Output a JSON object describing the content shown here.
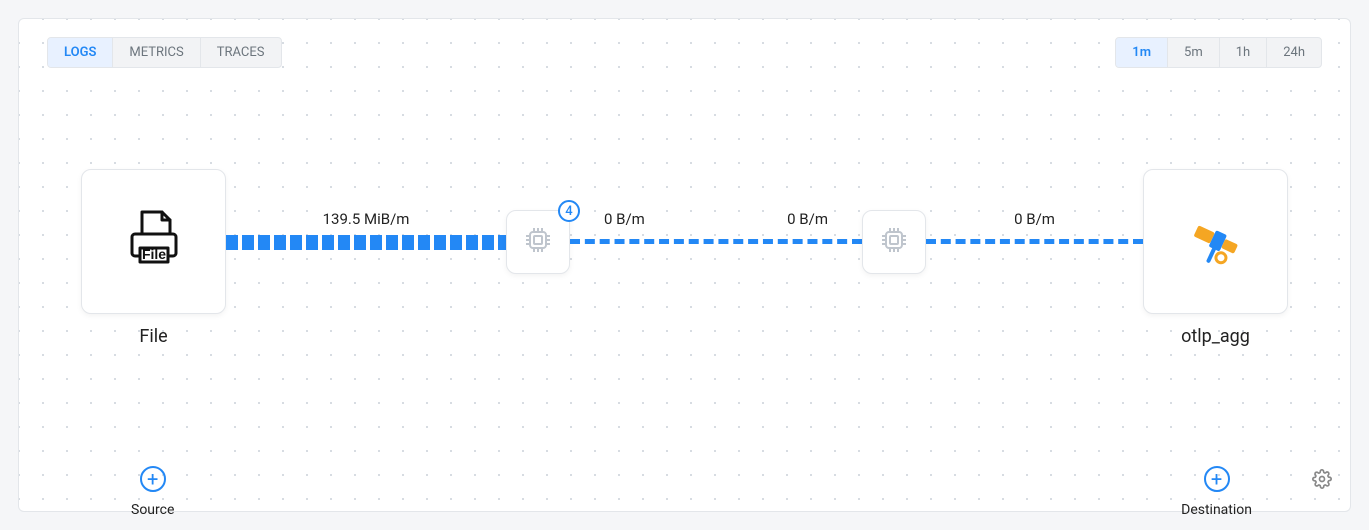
{
  "tabs": {
    "items": [
      "LOGS",
      "METRICS",
      "TRACES"
    ],
    "active": 0
  },
  "timeRange": {
    "items": [
      "1m",
      "5m",
      "1h",
      "24h"
    ],
    "active": 0
  },
  "source": {
    "title": "File",
    "icon": "file-printer-icon"
  },
  "dest": {
    "title": "otlp_agg",
    "icon": "telescope-icon"
  },
  "proc1": {
    "badge": "4"
  },
  "edges": {
    "e1": {
      "label": "139.5 MiB/m",
      "style": "solid"
    },
    "e2": {
      "label": "0 B/m",
      "style": "dashed"
    },
    "e3": {
      "label": "0 B/m",
      "style": "dashed"
    },
    "e4": {
      "label": "0 B/m",
      "style": "dashed"
    }
  },
  "add": {
    "source": "Source",
    "dest": "Destination"
  }
}
